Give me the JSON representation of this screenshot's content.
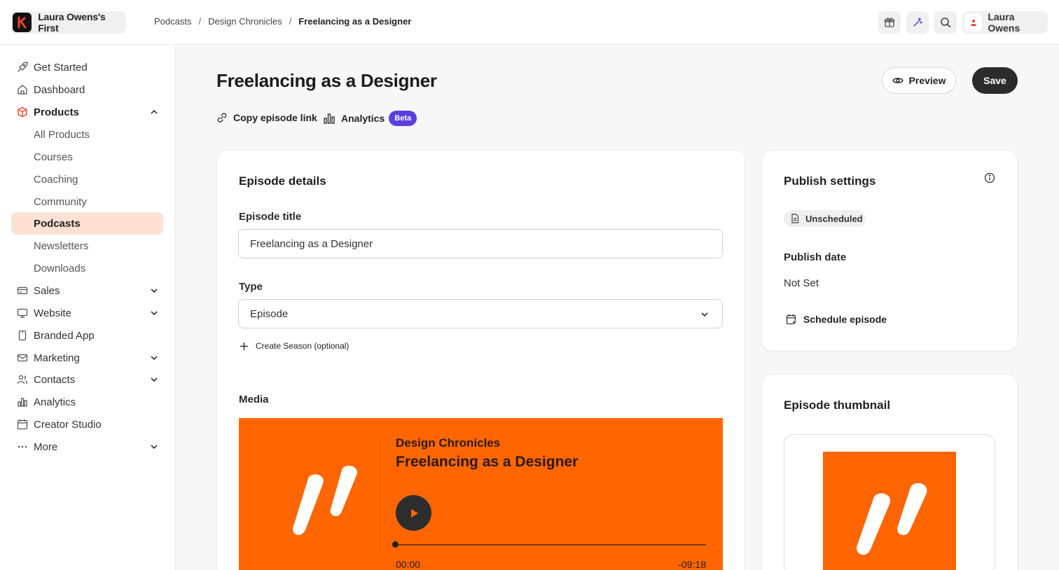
{
  "brand": {
    "name": "Laura Owens's First"
  },
  "breadcrumb": [
    "Podcasts",
    "Design Chronicles",
    "Freelancing as a Designer"
  ],
  "user": {
    "name": "Laura Owens"
  },
  "sidebar": {
    "items": [
      {
        "label": "Get Started",
        "icon": "rocket-icon"
      },
      {
        "label": "Dashboard",
        "icon": "home-icon"
      },
      {
        "label": "Products",
        "icon": "box-icon"
      },
      {
        "label": "All Products"
      },
      {
        "label": "Courses"
      },
      {
        "label": "Coaching"
      },
      {
        "label": "Community"
      },
      {
        "label": "Podcasts"
      },
      {
        "label": "Newsletters"
      },
      {
        "label": "Downloads"
      },
      {
        "label": "Sales",
        "icon": "card-icon"
      },
      {
        "label": "Website",
        "icon": "monitor-icon"
      },
      {
        "label": "Branded App",
        "icon": "phone-icon"
      },
      {
        "label": "Marketing",
        "icon": "mail-icon"
      },
      {
        "label": "Contacts",
        "icon": "users-icon"
      },
      {
        "label": "Analytics",
        "icon": "chart-icon"
      },
      {
        "label": "Creator Studio",
        "icon": "calendar-icon"
      },
      {
        "label": "More",
        "icon": "dots-icon"
      }
    ]
  },
  "page": {
    "title": "Freelancing as a Designer",
    "preview_label": "Preview",
    "save_label": "Save",
    "copy_link_label": "Copy episode link",
    "analytics_label": "Analytics",
    "beta_label": "Beta"
  },
  "episode_details": {
    "title": "Episode details",
    "episode_title_label": "Episode title",
    "episode_title_value": "Freelancing as a Designer",
    "type_label": "Type",
    "type_value": "Episode",
    "create_season_label": "Create Season (optional)",
    "media_label": "Media"
  },
  "player": {
    "show": "Design Chronicles",
    "episode": "Freelancing as a Designer",
    "time_elapsed": "00:00",
    "time_remaining": "-09:18",
    "progress": 0
  },
  "publish": {
    "title": "Publish settings",
    "status": "Unscheduled",
    "date_label": "Publish date",
    "date_value": "Not Set",
    "schedule_label": "Schedule episode"
  },
  "thumbnail": {
    "title": "Episode thumbnail"
  },
  "colors": {
    "accent": "#ff6602",
    "active_nav_bg": "#fde2d4",
    "beta": "#5b3ee0",
    "brand_mark": "#e8412c"
  }
}
